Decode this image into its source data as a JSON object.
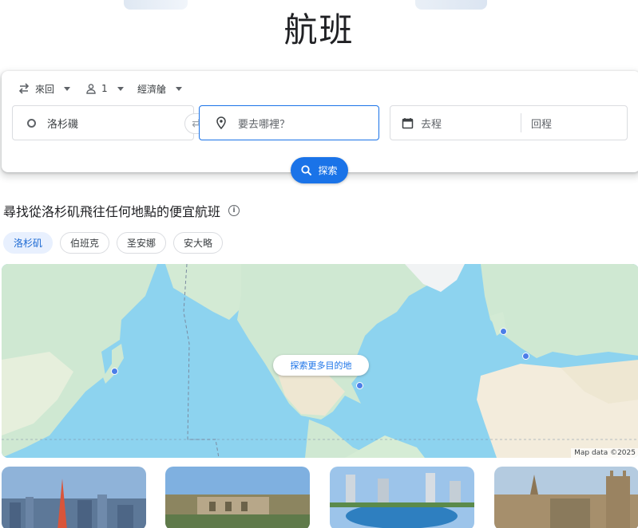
{
  "page": {
    "title": "航班"
  },
  "search": {
    "trip_type": "來回",
    "passengers": "1",
    "cabin": "經濟艙",
    "origin": "洛杉磯",
    "destination_placeholder": "要去哪裡？",
    "depart_placeholder": "去程",
    "return_placeholder": "回程",
    "search_label": "探索"
  },
  "deals": {
    "title": "尋找從洛杉矶飛往任何地點的便宜航班",
    "chips": [
      {
        "label": "洛杉矶",
        "active": true
      },
      {
        "label": "伯班克",
        "active": false
      },
      {
        "label": "圣安娜",
        "active": false
      },
      {
        "label": "安大略",
        "active": false
      }
    ]
  },
  "map": {
    "explore_label": "探索更多目的地",
    "attribution": "Map data ©2025"
  },
  "colors": {
    "accent": "#1a73e8",
    "water": "#8dd3ef",
    "land": "#cfe8d2",
    "desert": "#f3ecdc"
  },
  "icons": {
    "trip": "swap-arrows-icon",
    "pax": "person-icon",
    "origin": "ring-icon",
    "destination": "location-pin-icon",
    "dates": "calendar-icon",
    "search": "search-icon",
    "info": "info-icon"
  }
}
